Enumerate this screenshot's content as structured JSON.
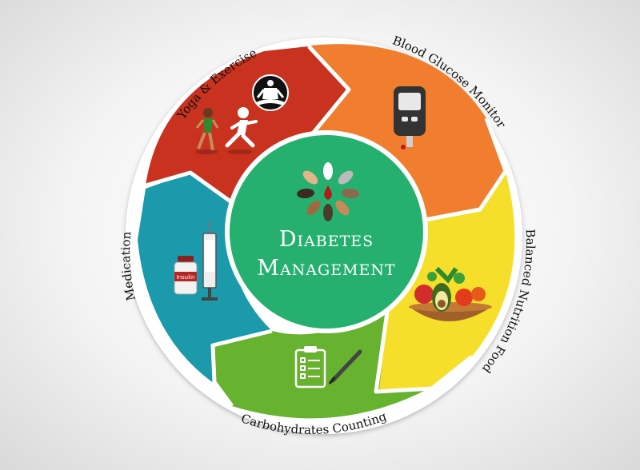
{
  "diagram": {
    "center": {
      "line1": "Diabetes",
      "line2": "Management"
    },
    "segments": [
      {
        "id": "yoga",
        "label": "Yoga & Exercise",
        "color": "#c8321f"
      },
      {
        "id": "glucose",
        "label": "Blood Glucose Monitor",
        "color": "#f07e2e"
      },
      {
        "id": "nutrition",
        "label": "Balanced Nutrition Food",
        "color": "#f6df2a"
      },
      {
        "id": "carbs",
        "label": "Carbohydrates Counting",
        "color": "#67b22e"
      },
      {
        "id": "medication",
        "label": "Medication",
        "color": "#1a9aaa"
      }
    ],
    "center_color": "#26b06f",
    "vial_label": "Insulin"
  }
}
